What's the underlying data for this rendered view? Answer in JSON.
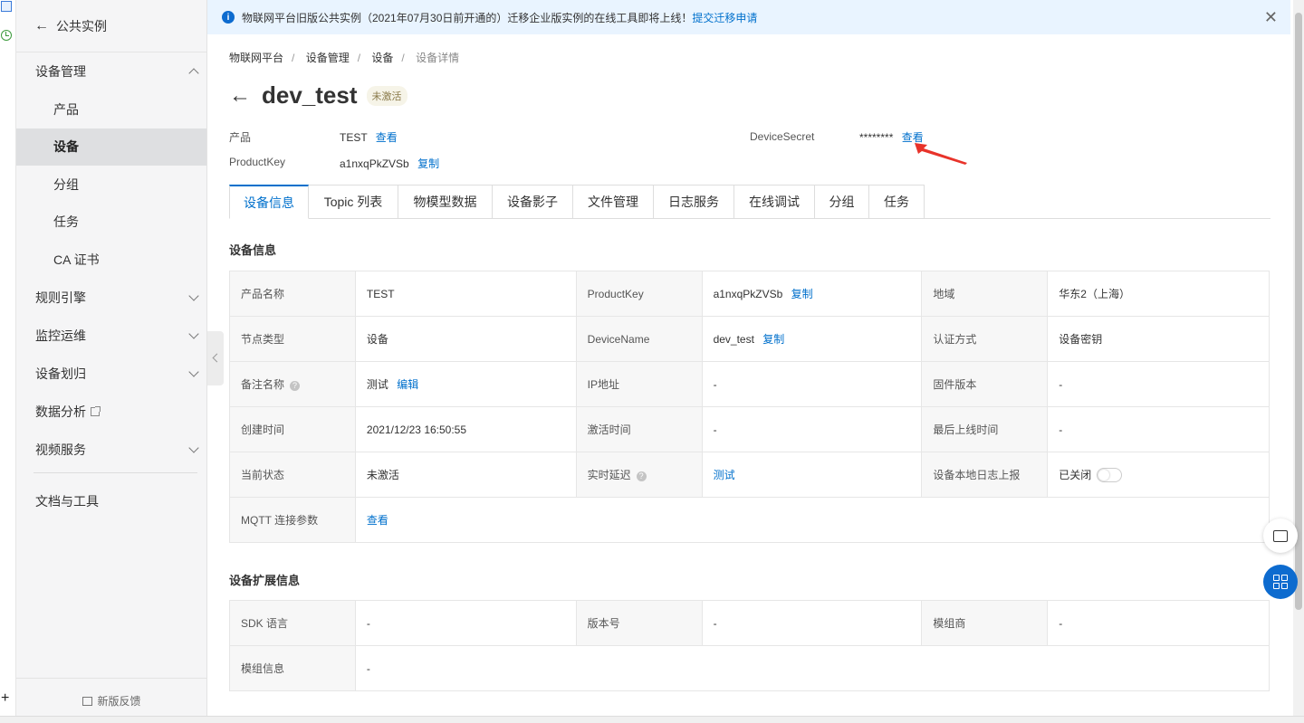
{
  "sidebar": {
    "back_label": "公共实例",
    "groups": {
      "device_mgmt": "设备管理",
      "rule_engine": "规则引擎",
      "monitor": "监控运维",
      "transfer": "设备划归",
      "analytics": "数据分析",
      "video": "视频服务",
      "docs": "文档与工具"
    },
    "items": [
      "产品",
      "设备",
      "分组",
      "任务",
      "CA 证书"
    ],
    "active_item": "设备",
    "feedback": "新版反馈"
  },
  "notice": {
    "text": "物联网平台旧版公共实例（2021年07月30日前开通的）迁移企业版实例的在线工具即将上线！",
    "link": "提交迁移申请"
  },
  "breadcrumb": [
    "物联网平台",
    "设备管理",
    "设备",
    "设备详情"
  ],
  "header": {
    "title": "dev_test",
    "status_badge": "未激活",
    "product_label": "产品",
    "product_value": "TEST",
    "product_link": "查看",
    "productkey_label": "ProductKey",
    "productkey_value": "a1nxqPkZVSb",
    "productkey_link": "复制",
    "secret_label": "DeviceSecret",
    "secret_value": "********",
    "secret_link": "查看"
  },
  "tabs": [
    "设备信息",
    "Topic 列表",
    "物模型数据",
    "设备影子",
    "文件管理",
    "日志服务",
    "在线调试",
    "分组",
    "任务"
  ],
  "active_tab": "设备信息",
  "device_info": {
    "title": "设备信息",
    "rows": [
      {
        "l1": "产品名称",
        "v1": "TEST",
        "l2": "ProductKey",
        "v2": "a1nxqPkZVSb",
        "v2_link": "复制",
        "l3": "地域",
        "v3": "华东2（上海）"
      },
      {
        "l1": "节点类型",
        "v1": "设备",
        "l2": "DeviceName",
        "v2": "dev_test",
        "v2_link": "复制",
        "l3": "认证方式",
        "v3": "设备密钥"
      },
      {
        "l1": "备注名称",
        "v1": "测试",
        "v1_link": "编辑",
        "l2": "IP地址",
        "v2": "-",
        "l3": "固件版本",
        "v3": "-"
      },
      {
        "l1": "创建时间",
        "v1": "2021/12/23 16:50:55",
        "l2": "激活时间",
        "v2": "-",
        "l3": "最后上线时间",
        "v3": "-"
      },
      {
        "l1": "当前状态",
        "v1": "未激活",
        "l2": "实时延迟",
        "v2_link": "测试",
        "l3": "设备本地日志上报",
        "v3": "已关闭"
      },
      {
        "l1": "MQTT 连接参数",
        "v1_link": "查看"
      }
    ]
  },
  "ext_info": {
    "title": "设备扩展信息",
    "rows": [
      {
        "l1": "SDK 语言",
        "v1": "-",
        "l2": "版本号",
        "v2": "-",
        "l3": "模组商",
        "v3": "-"
      },
      {
        "l1": "模组信息",
        "v1": "-"
      }
    ]
  },
  "colors": {
    "accent": "#0070cc",
    "notice_bg": "#e9f4ff",
    "annotation_arrow": "#e8332a"
  },
  "icons": [
    "back-arrow-icon",
    "info-icon",
    "close-icon",
    "chevron-icon",
    "external-link-icon",
    "help-icon",
    "chat-icon",
    "apps-icon",
    "feedback-icon"
  ]
}
